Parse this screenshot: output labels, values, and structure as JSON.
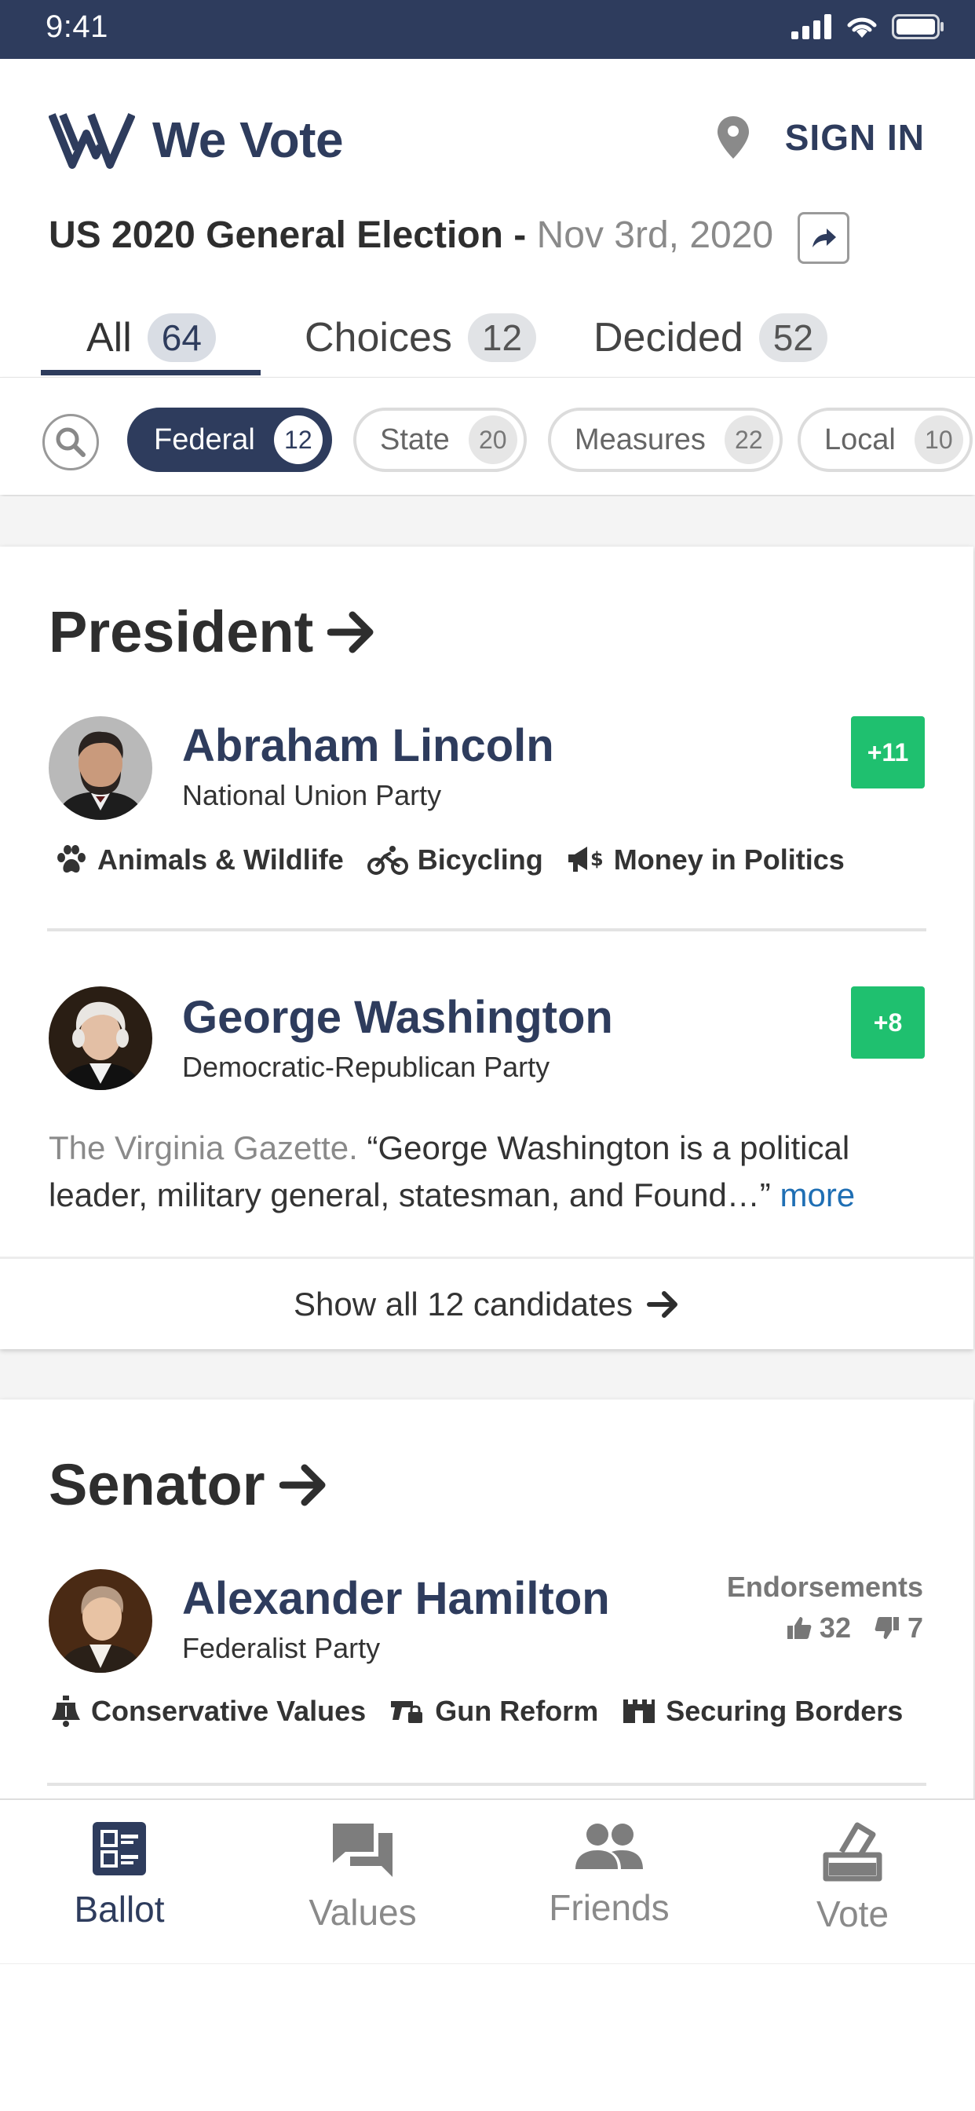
{
  "status_bar": {
    "time": "9:41"
  },
  "header": {
    "logo_text": "We Vote",
    "sign_in_label": "SIGN IN",
    "election_name": "US 2020 General Election -",
    "election_date": "Nov 3rd, 2020"
  },
  "tabs": [
    {
      "label": "All",
      "count": "64",
      "active": true
    },
    {
      "label": "Choices",
      "count": "12",
      "active": false
    },
    {
      "label": "Decided",
      "count": "52",
      "active": false
    }
  ],
  "filters": [
    {
      "label": "Federal",
      "count": "12",
      "active": true
    },
    {
      "label": "State",
      "count": "20",
      "active": false
    },
    {
      "label": "Measures",
      "count": "22",
      "active": false
    },
    {
      "label": "Local",
      "count": "10",
      "active": false
    }
  ],
  "offices": [
    {
      "title": "President",
      "candidates": [
        {
          "name": "Abraham Lincoln",
          "party": "National Union Party",
          "score": "+11",
          "issues": [
            "Animals & Wildlife",
            "Bicycling",
            "Money in Politics"
          ]
        },
        {
          "name": "George Washington",
          "party": "Democratic-Republican Party",
          "score": "+8",
          "quote_source": "The Virginia Gazette.",
          "quote_text": "“George Washington is a political leader, military general, statesman, and Found…”",
          "more_label": "more"
        }
      ],
      "show_all_label": "Show all 12 candidates"
    },
    {
      "title": "Senator",
      "candidates": [
        {
          "name": "Alexander Hamilton",
          "party": "Federalist Party",
          "endorsements_label": "Endorsements",
          "endorse_up": "32",
          "endorse_down": "7",
          "issues": [
            "Conservative Values",
            "Gun Reform",
            "Securing Borders"
          ]
        }
      ]
    }
  ],
  "bottom_nav": [
    {
      "label": "Ballot",
      "icon": "ballot-icon",
      "active": true
    },
    {
      "label": "Values",
      "icon": "values-icon",
      "active": false
    },
    {
      "label": "Friends",
      "icon": "friends-icon",
      "active": false
    },
    {
      "label": "Vote",
      "icon": "vote-icon",
      "active": false
    }
  ],
  "colors": {
    "brand_navy": "#2e3c5d",
    "score_green": "#1fc06f",
    "link_blue": "#1f6fb4"
  }
}
